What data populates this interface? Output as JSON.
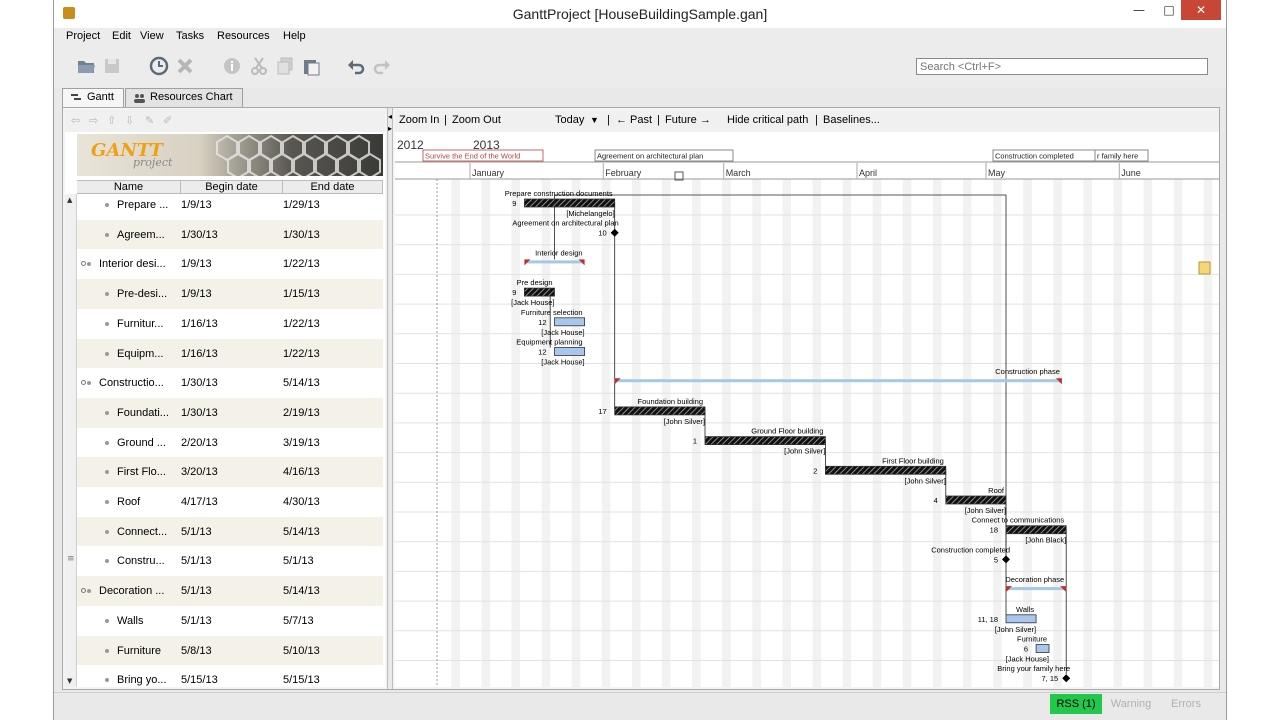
{
  "window": {
    "title": "GanttProject [HouseBuildingSample.gan]",
    "min": "—",
    "max": "□",
    "close": "✕"
  },
  "menu": [
    "Project",
    "Edit",
    "View",
    "Tasks",
    "Resources",
    "Help"
  ],
  "toolbar": {
    "icons": [
      "open-icon",
      "save-icon",
      "clock-icon",
      "delete-icon",
      "info-icon",
      "cut-icon",
      "copy-icon",
      "paste-icon",
      "undo-icon",
      "redo-icon"
    ],
    "search_placeholder": "Search <Ctrl+F>"
  },
  "tabs": [
    {
      "label": "Gantt",
      "active": true
    },
    {
      "label": "Resources Chart",
      "active": false
    }
  ],
  "logo": {
    "text": "GANTT",
    "sub": "project"
  },
  "columns": [
    "Name",
    "Begin date",
    "End date"
  ],
  "tasks": [
    {
      "name": "Prepare ...",
      "begin": "1/9/13",
      "end": "1/29/13",
      "level": 1
    },
    {
      "name": "Agreem...",
      "begin": "1/30/13",
      "end": "1/30/13",
      "level": 1
    },
    {
      "name": "Interior desi...",
      "begin": "1/9/13",
      "end": "1/22/13",
      "level": 0
    },
    {
      "name": "Pre-desi...",
      "begin": "1/9/13",
      "end": "1/15/13",
      "level": 1
    },
    {
      "name": "Furnitur...",
      "begin": "1/16/13",
      "end": "1/22/13",
      "level": 1
    },
    {
      "name": "Equipm...",
      "begin": "1/16/13",
      "end": "1/22/13",
      "level": 1
    },
    {
      "name": "Constructio...",
      "begin": "1/30/13",
      "end": "5/14/13",
      "level": 0
    },
    {
      "name": "Foundati...",
      "begin": "1/30/13",
      "end": "2/19/13",
      "level": 1
    },
    {
      "name": "Ground ...",
      "begin": "2/20/13",
      "end": "3/19/13",
      "level": 1
    },
    {
      "name": "First Flo...",
      "begin": "3/20/13",
      "end": "4/16/13",
      "level": 1
    },
    {
      "name": "Roof",
      "begin": "4/17/13",
      "end": "4/30/13",
      "level": 1
    },
    {
      "name": "Connect...",
      "begin": "5/1/13",
      "end": "5/14/13",
      "level": 1
    },
    {
      "name": "Constru...",
      "begin": "5/1/13",
      "end": "5/1/13",
      "level": 1
    },
    {
      "name": "Decoration ...",
      "begin": "5/1/13",
      "end": "5/14/13",
      "level": 0
    },
    {
      "name": "Walls",
      "begin": "5/1/13",
      "end": "5/7/13",
      "level": 1
    },
    {
      "name": "Furniture",
      "begin": "5/8/13",
      "end": "5/10/13",
      "level": 1
    },
    {
      "name": "Bring yo...",
      "begin": "5/15/13",
      "end": "5/15/13",
      "level": 1
    }
  ],
  "chart_toolbar": {
    "zoom_in": "Zoom In",
    "sep1": "|",
    "zoom_out": "Zoom Out",
    "today": "Today",
    "today_arrow": "▼",
    "sep2": "|",
    "past": "← Past",
    "sep3": "|",
    "future": "Future →",
    "critical": "Hide critical path",
    "sep4": "|",
    "baselines": "Baselines..."
  },
  "timeline": {
    "years": [
      "2012",
      "2013"
    ],
    "months": [
      "January",
      "February",
      "March",
      "April",
      "May",
      "June"
    ],
    "milestone_flags": [
      "Survive the End of the World",
      "Agreement on architectural plan",
      "Construction completed",
      "r family here"
    ]
  },
  "bars": [
    {
      "label": "Prepare construction documents",
      "num": "9",
      "resource": "[Michelangelo]"
    },
    {
      "label": "Agreement on architectural plan",
      "num": "10",
      "resource": ""
    },
    {
      "label": "Interior design",
      "num": "",
      "resource": ""
    },
    {
      "label": "Pre design",
      "num": "9",
      "resource": "[Jack House]"
    },
    {
      "label": "Furniture selection",
      "num": "12",
      "resource": "[Jack House]"
    },
    {
      "label": "Equipment planning",
      "num": "12",
      "resource": "[Jack House]"
    },
    {
      "label": "Construction phase",
      "num": "",
      "resource": ""
    },
    {
      "label": "Foundation building",
      "num": "17",
      "resource": "[John Silver]"
    },
    {
      "label": "Ground Floor building",
      "num": "1",
      "resource": "[John Silver]"
    },
    {
      "label": "First Floor building",
      "num": "2",
      "resource": "[John Silver]"
    },
    {
      "label": "Roof",
      "num": "4",
      "resource": "[John Silver]"
    },
    {
      "label": "Connect to communications",
      "num": "18",
      "resource": "[John Black]"
    },
    {
      "label": "Construction completed",
      "num": "5",
      "resource": ""
    },
    {
      "label": "Decoration phase",
      "num": "",
      "resource": ""
    },
    {
      "label": "Walls",
      "num": "11, 18",
      "resource": "[John Silver]"
    },
    {
      "label": "Furniture",
      "num": "6",
      "resource": "[Jack House]"
    },
    {
      "label": "Bring your family here",
      "num": "7, 15",
      "resource": ""
    }
  ],
  "status": {
    "rss": "RSS (1)",
    "warning": "Warning",
    "errors": "Errors"
  },
  "colors": {
    "bar_fill": "#a9c7ee",
    "summary": "#a4c8e8",
    "close": "#c74636",
    "rss": "#22c84c"
  }
}
